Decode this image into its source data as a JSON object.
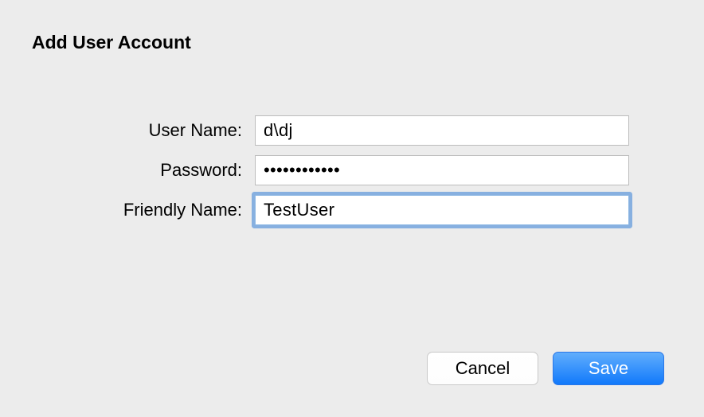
{
  "dialog": {
    "title": "Add User Account",
    "fields": {
      "username": {
        "label": "User Name:",
        "value": "d\\dj"
      },
      "password": {
        "label": "Password:",
        "value": "••••••••••••"
      },
      "friendly_name": {
        "label": "Friendly Name:",
        "value": "TestUser"
      }
    },
    "buttons": {
      "cancel": "Cancel",
      "save": "Save"
    }
  }
}
